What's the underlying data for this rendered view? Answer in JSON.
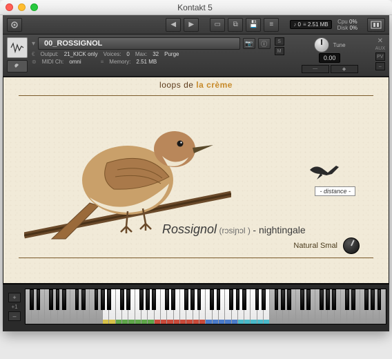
{
  "titlebar": {
    "title": "Kontakt 5"
  },
  "toolbar": {
    "meters": {
      "note_icon": "♪",
      "note_val": "0",
      "mem_icon": "≡",
      "mem_val": "2.51 MB",
      "cpu_label": "Cpu",
      "cpu_val": "0%",
      "disk_label": "Disk",
      "disk_val": "0%"
    }
  },
  "instrument": {
    "name": "00_ROSSIGNOL",
    "output_label": "Output:",
    "output_val": "21_KICK only",
    "voices_label": "Voices:",
    "voices_val": "0",
    "max_label": "Max:",
    "max_val": "32",
    "purge_label": "Purge",
    "midi_label": "MIDI Ch:",
    "midi_val": "omni",
    "memory_label": "Memory:",
    "memory_val": "2.51 MB",
    "tune_label": "Tune",
    "tune_val": "0.00",
    "solo": "S",
    "mute": "M",
    "aux_label": "AUX"
  },
  "body": {
    "brand_a": "loops de ",
    "brand_b": "la crème",
    "distance_label": "- distance -",
    "caption_name": "Rossignol",
    "caption_ipa": "(rɔsiɲɔl )",
    "caption_dash": " - ",
    "caption_eng": "nightingale",
    "natural_label": "Natural Smal"
  },
  "keyboard": {
    "transpose": "+1",
    "minus": "–",
    "plus": "+"
  }
}
